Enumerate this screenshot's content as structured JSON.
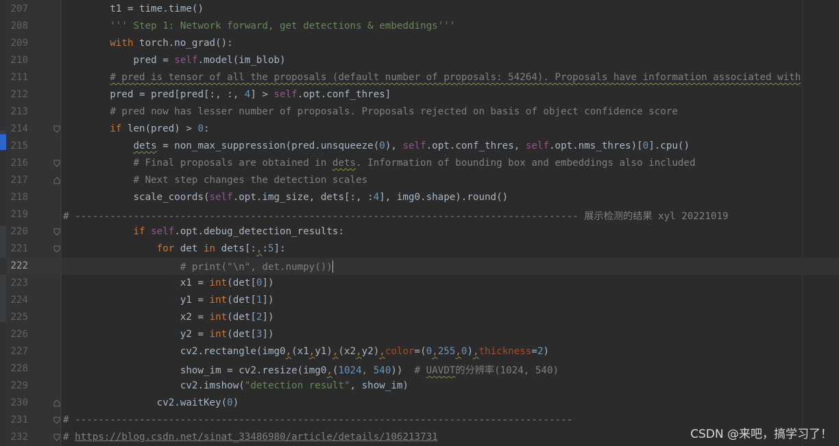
{
  "editor": {
    "current_line": "222",
    "lines": [
      {
        "no": "207",
        "fold": "",
        "segments": [
          {
            "t": "        t1 = time.time()",
            "c": ""
          }
        ]
      },
      {
        "no": "208",
        "fold": "",
        "segments": [
          {
            "t": "        ''' Step 1: Network forward, get detections & embeddings'''",
            "c": "s"
          }
        ]
      },
      {
        "no": "209",
        "fold": "",
        "segments": [
          {
            "t": "        ",
            "c": ""
          },
          {
            "t": "with",
            "c": "k"
          },
          {
            "t": " torch.no_grad():",
            "c": ""
          }
        ]
      },
      {
        "no": "210",
        "fold": "",
        "segments": [
          {
            "t": "            pred = ",
            "c": ""
          },
          {
            "t": "self",
            "c": "sf"
          },
          {
            "t": ".model(im_blob)",
            "c": ""
          }
        ]
      },
      {
        "no": "211",
        "fold": "",
        "segments": [
          {
            "t": "        ",
            "c": ""
          },
          {
            "t": "# pred is tensor of all the proposals (default number of proposals: 54264). Proposals have information associated with",
            "c": "c squig"
          }
        ]
      },
      {
        "no": "212",
        "fold": "",
        "segments": [
          {
            "t": "        pred = pred[pred[:, :, ",
            "c": ""
          },
          {
            "t": "4",
            "c": "n"
          },
          {
            "t": "] > ",
            "c": ""
          },
          {
            "t": "self",
            "c": "sf"
          },
          {
            "t": ".opt.conf_thres]",
            "c": ""
          }
        ]
      },
      {
        "no": "213",
        "fold": "",
        "segments": [
          {
            "t": "        # pred now has lesser number of proposals. Proposals rejected on basis of object confidence score",
            "c": "c"
          }
        ]
      },
      {
        "no": "214",
        "fold": "open",
        "segments": [
          {
            "t": "        ",
            "c": ""
          },
          {
            "t": "if",
            "c": "k"
          },
          {
            "t": " len(pred) > ",
            "c": ""
          },
          {
            "t": "0",
            "c": "n"
          },
          {
            "t": ":",
            "c": ""
          }
        ]
      },
      {
        "no": "215",
        "fold": "",
        "segments": [
          {
            "t": "            ",
            "c": ""
          },
          {
            "t": "dets",
            "c": "squig"
          },
          {
            "t": " = non_max_suppression(pred.unsqueeze(",
            "c": ""
          },
          {
            "t": "0",
            "c": "n"
          },
          {
            "t": "), ",
            "c": ""
          },
          {
            "t": "self",
            "c": "sf"
          },
          {
            "t": ".opt.conf_thres, ",
            "c": ""
          },
          {
            "t": "self",
            "c": "sf"
          },
          {
            "t": ".opt.nms_thres)[",
            "c": ""
          },
          {
            "t": "0",
            "c": "n"
          },
          {
            "t": "].cpu()",
            "c": ""
          }
        ]
      },
      {
        "no": "216",
        "fold": "open",
        "segments": [
          {
            "t": "            # Final proposals are obtained in ",
            "c": "c"
          },
          {
            "t": "dets",
            "c": "c squig"
          },
          {
            "t": ". Information of bounding box and embeddings also included",
            "c": "c"
          }
        ]
      },
      {
        "no": "217",
        "fold": "close",
        "segments": [
          {
            "t": "            # Next step changes the detection scales",
            "c": "c"
          }
        ]
      },
      {
        "no": "218",
        "fold": "",
        "segments": [
          {
            "t": "            scale_coords(",
            "c": ""
          },
          {
            "t": "self",
            "c": "sf"
          },
          {
            "t": ".opt.img_size, dets[:, :",
            "c": ""
          },
          {
            "t": "4",
            "c": "n"
          },
          {
            "t": "], img0.shape).round()",
            "c": ""
          }
        ]
      },
      {
        "no": "219",
        "fold": "",
        "segments": [
          {
            "t": "# -------------------------------------------------------------------------------------- 展示检测的结果 xyl 20221019",
            "c": "c"
          }
        ]
      },
      {
        "no": "220",
        "fold": "open",
        "segments": [
          {
            "t": "            ",
            "c": ""
          },
          {
            "t": "if",
            "c": "k"
          },
          {
            "t": " ",
            "c": ""
          },
          {
            "t": "self",
            "c": "sf"
          },
          {
            "t": ".opt.debug_detection_results:",
            "c": ""
          }
        ]
      },
      {
        "no": "221",
        "fold": "open",
        "segments": [
          {
            "t": "                ",
            "c": ""
          },
          {
            "t": "for",
            "c": "k"
          },
          {
            "t": " det ",
            "c": ""
          },
          {
            "t": "in",
            "c": "k"
          },
          {
            "t": " dets[:",
            "c": ""
          },
          {
            "t": ",",
            "c": "k squig"
          },
          {
            "t": ":",
            "c": ""
          },
          {
            "t": "5",
            "c": "n"
          },
          {
            "t": "]:",
            "c": ""
          }
        ]
      },
      {
        "no": "222",
        "fold": "",
        "segments": [
          {
            "t": "                    # print(\"\\n\", det.numpy())",
            "c": "c"
          }
        ]
      },
      {
        "no": "223",
        "fold": "",
        "segments": [
          {
            "t": "                    x1 = ",
            "c": ""
          },
          {
            "t": "int",
            "c": "k"
          },
          {
            "t": "(det[",
            "c": ""
          },
          {
            "t": "0",
            "c": "n"
          },
          {
            "t": "])",
            "c": ""
          }
        ]
      },
      {
        "no": "224",
        "fold": "",
        "segments": [
          {
            "t": "                    y1 = ",
            "c": ""
          },
          {
            "t": "int",
            "c": "k"
          },
          {
            "t": "(det[",
            "c": ""
          },
          {
            "t": "1",
            "c": "n"
          },
          {
            "t": "])",
            "c": ""
          }
        ]
      },
      {
        "no": "225",
        "fold": "",
        "segments": [
          {
            "t": "                    x2 = ",
            "c": ""
          },
          {
            "t": "int",
            "c": "k"
          },
          {
            "t": "(det[",
            "c": ""
          },
          {
            "t": "2",
            "c": "n"
          },
          {
            "t": "])",
            "c": ""
          }
        ]
      },
      {
        "no": "226",
        "fold": "",
        "segments": [
          {
            "t": "                    y2 = ",
            "c": ""
          },
          {
            "t": "int",
            "c": "k"
          },
          {
            "t": "(det[",
            "c": ""
          },
          {
            "t": "3",
            "c": "n"
          },
          {
            "t": "])",
            "c": ""
          }
        ]
      },
      {
        "no": "227",
        "fold": "",
        "segments": [
          {
            "t": "                    cv2.rectangle(img0",
            "c": ""
          },
          {
            "t": ",",
            "c": "k squig"
          },
          {
            "t": "(x1",
            "c": ""
          },
          {
            "t": ",",
            "c": "k squig"
          },
          {
            "t": "y1)",
            "c": ""
          },
          {
            "t": ",",
            "c": "k squig"
          },
          {
            "t": "(x2",
            "c": ""
          },
          {
            "t": ",",
            "c": "k squig"
          },
          {
            "t": "y2)",
            "c": ""
          },
          {
            "t": ",",
            "c": "k squig"
          },
          {
            "t": "color",
            "c": "kw"
          },
          {
            "t": "=(",
            "c": ""
          },
          {
            "t": "0",
            "c": "n"
          },
          {
            "t": ",",
            "c": "k squig"
          },
          {
            "t": "255",
            "c": "n"
          },
          {
            "t": ",",
            "c": "k squig"
          },
          {
            "t": "0",
            "c": "n"
          },
          {
            "t": ")",
            "c": ""
          },
          {
            "t": ",",
            "c": "k squig"
          },
          {
            "t": "thickness",
            "c": "kw"
          },
          {
            "t": "=",
            "c": ""
          },
          {
            "t": "2",
            "c": "n"
          },
          {
            "t": ")",
            "c": ""
          }
        ]
      },
      {
        "no": "228",
        "fold": "",
        "segments": [
          {
            "t": "                    show_im = cv2.resize(img0",
            "c": ""
          },
          {
            "t": ",",
            "c": "k squig"
          },
          {
            "t": "(",
            "c": ""
          },
          {
            "t": "1024",
            "c": "n"
          },
          {
            "t": ", ",
            "c": "k"
          },
          {
            "t": "540",
            "c": "n"
          },
          {
            "t": "))  ",
            "c": ""
          },
          {
            "t": "# ",
            "c": "c"
          },
          {
            "t": "UAVDT",
            "c": "c squig"
          },
          {
            "t": "的分辨率(1024, 540)",
            "c": "c"
          }
        ]
      },
      {
        "no": "229",
        "fold": "",
        "segments": [
          {
            "t": "                    cv2.imshow(",
            "c": ""
          },
          {
            "t": "\"detection result\"",
            "c": "s"
          },
          {
            "t": ", show_im)",
            "c": ""
          }
        ]
      },
      {
        "no": "230",
        "fold": "close",
        "segments": [
          {
            "t": "                cv2.waitKey(",
            "c": ""
          },
          {
            "t": "0",
            "c": "n"
          },
          {
            "t": ")",
            "c": ""
          }
        ]
      },
      {
        "no": "231",
        "fold": "open",
        "segments": [
          {
            "t": "# -------------------------------------------------------------------------------------",
            "c": "c"
          }
        ]
      },
      {
        "no": "232",
        "fold": "open",
        "segments": [
          {
            "t": "# ",
            "c": "c"
          },
          {
            "t": "https://blog.csdn.net/sinat_33486980/article/details/106213731",
            "c": "c link"
          }
        ]
      }
    ]
  },
  "watermark": "CSDN @来吧，搞学习了！"
}
